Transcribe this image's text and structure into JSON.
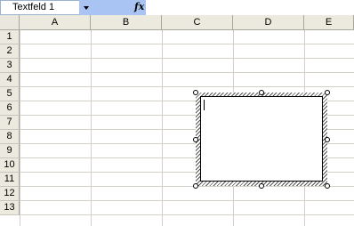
{
  "formula_bar": {
    "name_box_value": "Textfeld 1",
    "fx_label": "fx",
    "formula_value": ""
  },
  "columns": [
    "A",
    "B",
    "C",
    "D",
    "E"
  ],
  "rows": [
    "1",
    "2",
    "3",
    "4",
    "5",
    "6",
    "7",
    "8",
    "9",
    "10",
    "11",
    "12",
    "13"
  ],
  "textbox": {
    "name": "Textfeld 1",
    "content": "",
    "state": "editing"
  }
}
